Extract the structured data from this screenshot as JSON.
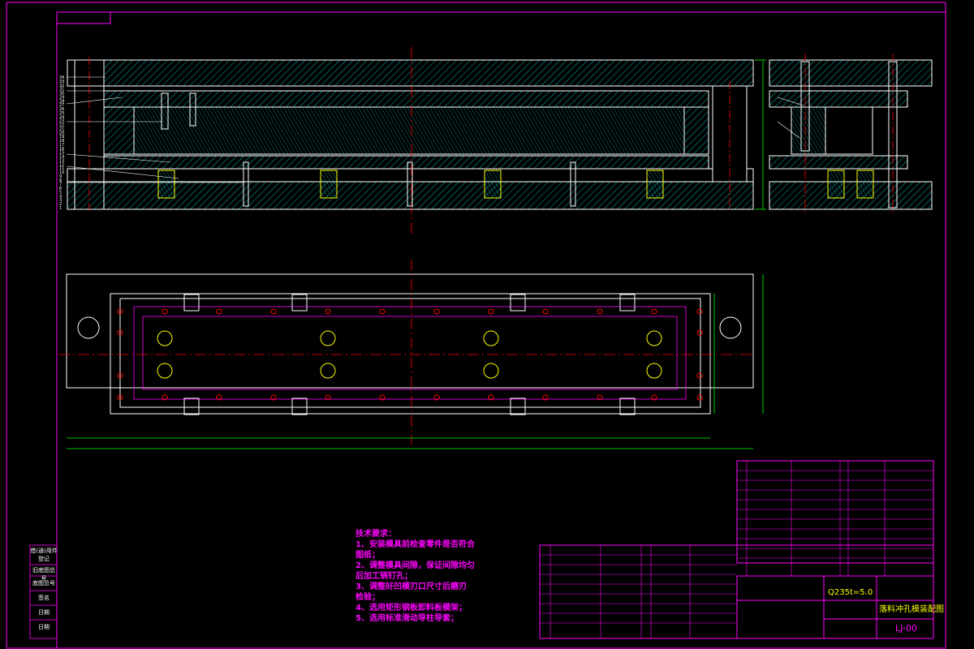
{
  "drawing": {
    "code": "LJ-00",
    "material": "Q235",
    "thickness": "t=5.0",
    "title": "落料冲孔模装配图"
  },
  "tech_requirements": {
    "heading": "技术要求：",
    "lines": [
      "1、安装模具前检查零件是否符合",
      "图纸；",
      "2、调整模具间隙，保证间隙均匀",
      "后加工销钉孔；",
      "3、调整好凹模刃口尺寸后磨刃",
      "检验；",
      "4、选用矩形钢板卸料板模架；",
      "5、选用标准滑动导柱导套；"
    ]
  },
  "side_labels": [
    "借(通)用件登记",
    "旧底图总号",
    "底图总号",
    "签名",
    "日期",
    "日期"
  ],
  "part_numbers": [
    "34",
    "33",
    "32",
    "31",
    "30",
    "29",
    "28",
    "27",
    "26",
    "25",
    "24",
    "23",
    "22",
    "21",
    "20",
    "19",
    "18",
    "17",
    "16",
    "15",
    "14",
    "13",
    "12",
    "11",
    "10",
    "9",
    "8",
    "7",
    "6",
    "5",
    "4",
    "3",
    "2",
    "1"
  ],
  "colors": {
    "background": "#000000",
    "border": "#ff00ff",
    "outline": "#ffffff",
    "hatch": "#00ffff",
    "center": "#ff0000",
    "dim": "#00ff00",
    "text": "#ffff00"
  }
}
